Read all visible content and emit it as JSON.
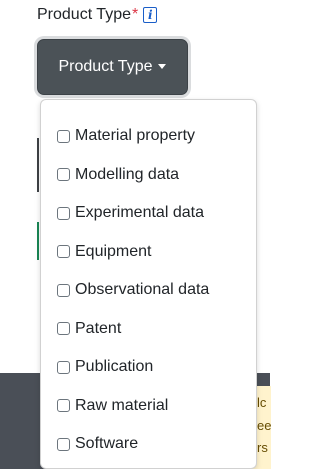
{
  "field": {
    "label": "Product Type",
    "required_marker": "*",
    "info_icon": "i"
  },
  "dropdown": {
    "toggle_label": "Product Type",
    "items": [
      {
        "label": "Material property",
        "checked": false
      },
      {
        "label": "Modelling data",
        "checked": false
      },
      {
        "label": "Experimental data",
        "checked": false
      },
      {
        "label": "Equipment",
        "checked": false
      },
      {
        "label": "Observational data",
        "checked": false
      },
      {
        "label": "Patent",
        "checked": false
      },
      {
        "label": "Publication",
        "checked": false
      },
      {
        "label": "Raw material",
        "checked": false
      },
      {
        "label": "Software",
        "checked": false
      }
    ]
  },
  "background_panel": {
    "partial_text": [
      "lc",
      "ee",
      "rs"
    ]
  },
  "colors": {
    "button_bg": "#4b5257",
    "required": "#dc3545",
    "info_icon": "#1a5ec8",
    "dark_band": "#4a4f57",
    "warning_panel": "#fff3cd"
  }
}
